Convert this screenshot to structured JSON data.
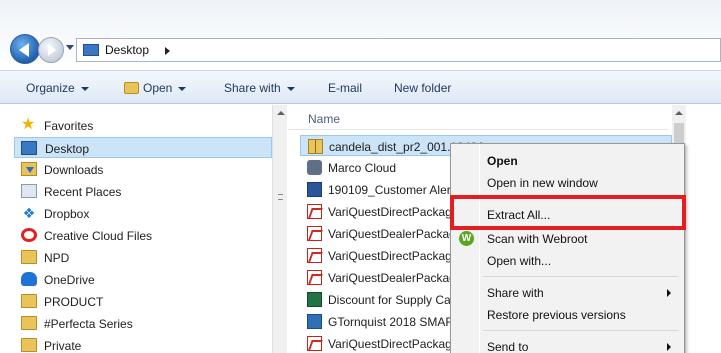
{
  "address": {
    "location": "Desktop"
  },
  "toolbar": {
    "organize": "Organize",
    "open": "Open",
    "share_with": "Share with",
    "email": "E-mail",
    "new_folder": "New folder"
  },
  "nav": {
    "items": [
      {
        "label": "Favorites",
        "icon": "star-icon"
      },
      {
        "label": "Desktop",
        "icon": "desktop-icon",
        "selected": true
      },
      {
        "label": "Downloads",
        "icon": "downloads-icon"
      },
      {
        "label": "Recent Places",
        "icon": "recent-places-icon"
      },
      {
        "label": "Dropbox",
        "icon": "dropbox-icon"
      },
      {
        "label": "Creative Cloud Files",
        "icon": "creative-cloud-icon"
      },
      {
        "label": "NPD",
        "icon": "folder-icon"
      },
      {
        "label": "OneDrive",
        "icon": "onedrive-icon"
      },
      {
        "label": "PRODUCT",
        "icon": "folder-icon"
      },
      {
        "label": "#Perfecta Series",
        "icon": "folder-icon"
      },
      {
        "label": "Private",
        "icon": "folder-icon"
      }
    ]
  },
  "files": {
    "column_name": "Name",
    "rows": [
      {
        "label": "candela_dist_pr2_001.1040A....",
        "icon": "zip-folder-icon",
        "selected": true
      },
      {
        "label": "Marco Cloud",
        "icon": "cloud-icon"
      },
      {
        "label": "190109_Customer Aler",
        "icon": "word-doc-icon"
      },
      {
        "label": "VariQuestDirectPackag",
        "icon": "pdf-icon"
      },
      {
        "label": "VariQuestDealerPackag",
        "icon": "pdf-icon"
      },
      {
        "label": "VariQuestDirectPackag",
        "icon": "pdf-icon"
      },
      {
        "label": "VariQuestDealerPackag",
        "icon": "pdf-icon"
      },
      {
        "label": "Discount for Supply Ca",
        "icon": "excel-icon"
      },
      {
        "label": "GTornquist 2018 SMAR",
        "icon": "spreadsheet-icon"
      },
      {
        "label": "VariQuestDirectPackag",
        "icon": "pdf-icon"
      }
    ]
  },
  "context_menu": {
    "open": "Open",
    "open_new_window": "Open in new window",
    "extract_all": "Extract All...",
    "scan_webroot": "Scan with Webroot",
    "open_with": "Open with...",
    "share_with": "Share with",
    "restore_previous": "Restore previous versions",
    "send_to": "Send to",
    "webroot_glyph": "W"
  },
  "colors": {
    "highlight_border": "#e21d24",
    "selection_bg": "#cce4f7"
  }
}
